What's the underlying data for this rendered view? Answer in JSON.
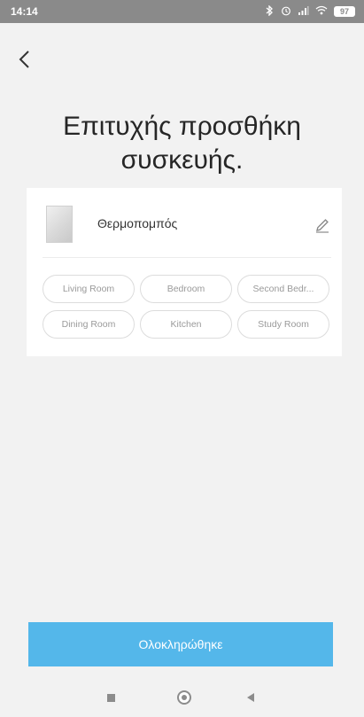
{
  "status_bar": {
    "time": "14:14",
    "battery": "97",
    "icons": [
      "bluetooth-icon",
      "alarm-icon",
      "signal-icon",
      "wifi-icon",
      "battery-icon"
    ]
  },
  "title": {
    "line1": "Επιτυχής προσθήκη",
    "line2": "συσκευής."
  },
  "device": {
    "name": "Θερμοπομπός"
  },
  "rooms": [
    "Living Room",
    "Bedroom",
    "Second Bedr...",
    "Dining Room",
    "Kitchen",
    "Study Room"
  ],
  "done_button": {
    "label": "Ολοκληρώθηκε"
  },
  "colors": {
    "accent": "#54b7ea",
    "background": "#f2f2f2",
    "status_bar": "#8a8a8a"
  }
}
